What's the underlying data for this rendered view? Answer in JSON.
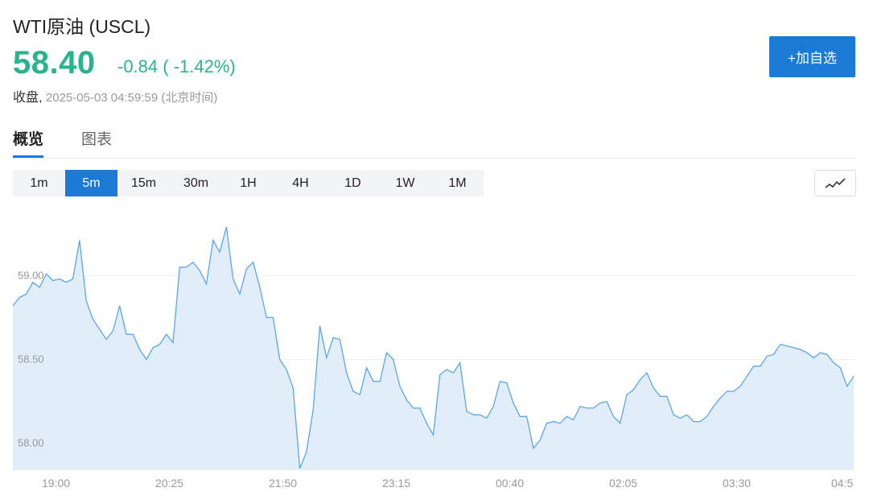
{
  "header": {
    "title": "WTI原油 (USCL)",
    "price": "58.40",
    "change": "-0.84 ( -1.42%)",
    "status_label": "收盘,",
    "timestamp": "2025-05-03 04:59:59 (北京时间)",
    "add_button": "+加自选"
  },
  "tabs": [
    {
      "label": "概览",
      "active": true
    },
    {
      "label": "图表",
      "active": false
    }
  ],
  "intervals": [
    {
      "label": "1m"
    },
    {
      "label": "5m",
      "active": true
    },
    {
      "label": "15m"
    },
    {
      "label": "30m"
    },
    {
      "label": "1H"
    },
    {
      "label": "4H"
    },
    {
      "label": "1D"
    },
    {
      "label": "1W"
    },
    {
      "label": "1M"
    }
  ],
  "chart_style_icon": "line-chart-icon",
  "colors": {
    "up_down_green": "#27b48a",
    "accent_blue": "#1a7ad6",
    "line": "#5aa6e8",
    "area": "#e1eefa"
  },
  "chart_data": {
    "type": "area",
    "y_ticks": [
      {
        "label": "59.00",
        "value": 59.0
      },
      {
        "label": "58.50",
        "value": 58.5
      },
      {
        "label": "58.00",
        "value": 58.0
      }
    ],
    "ylim": [
      57.84,
      59.39
    ],
    "x_ticks": [
      "19:00",
      "20:25",
      "21:50",
      "23:15",
      "00:40",
      "02:05",
      "03:30",
      "04:5"
    ],
    "grid": "horizontal",
    "values": [
      58.82,
      58.87,
      58.89,
      58.96,
      58.93,
      59.01,
      58.97,
      58.98,
      58.96,
      58.98,
      59.21,
      58.85,
      58.74,
      58.68,
      58.62,
      58.67,
      58.82,
      58.65,
      58.65,
      58.56,
      58.5,
      58.57,
      58.59,
      58.65,
      58.6,
      59.05,
      59.05,
      59.08,
      59.03,
      58.95,
      59.21,
      59.14,
      59.29,
      58.98,
      58.89,
      59.04,
      59.08,
      58.93,
      58.75,
      58.75,
      58.5,
      58.44,
      58.33,
      57.85,
      57.95,
      58.2,
      58.7,
      58.51,
      58.63,
      58.62,
      58.42,
      58.31,
      58.29,
      58.45,
      58.37,
      58.37,
      58.54,
      58.5,
      58.34,
      58.26,
      58.21,
      58.21,
      58.12,
      58.05,
      58.41,
      58.44,
      58.42,
      58.48,
      58.19,
      58.17,
      58.17,
      58.15,
      58.22,
      58.37,
      58.36,
      58.24,
      58.16,
      58.16,
      57.97,
      58.02,
      58.12,
      58.13,
      58.12,
      58.16,
      58.14,
      58.22,
      58.21,
      58.21,
      58.24,
      58.25,
      58.16,
      58.12,
      58.29,
      58.32,
      58.38,
      58.42,
      58.33,
      58.28,
      58.28,
      58.17,
      58.15,
      58.17,
      58.13,
      58.13,
      58.16,
      58.22,
      58.27,
      58.31,
      58.31,
      58.34,
      58.4,
      58.46,
      58.46,
      58.52,
      58.53,
      58.59,
      58.58,
      58.57,
      58.56,
      58.54,
      58.51,
      58.54,
      58.53,
      58.48,
      58.45,
      58.34,
      58.4
    ]
  }
}
